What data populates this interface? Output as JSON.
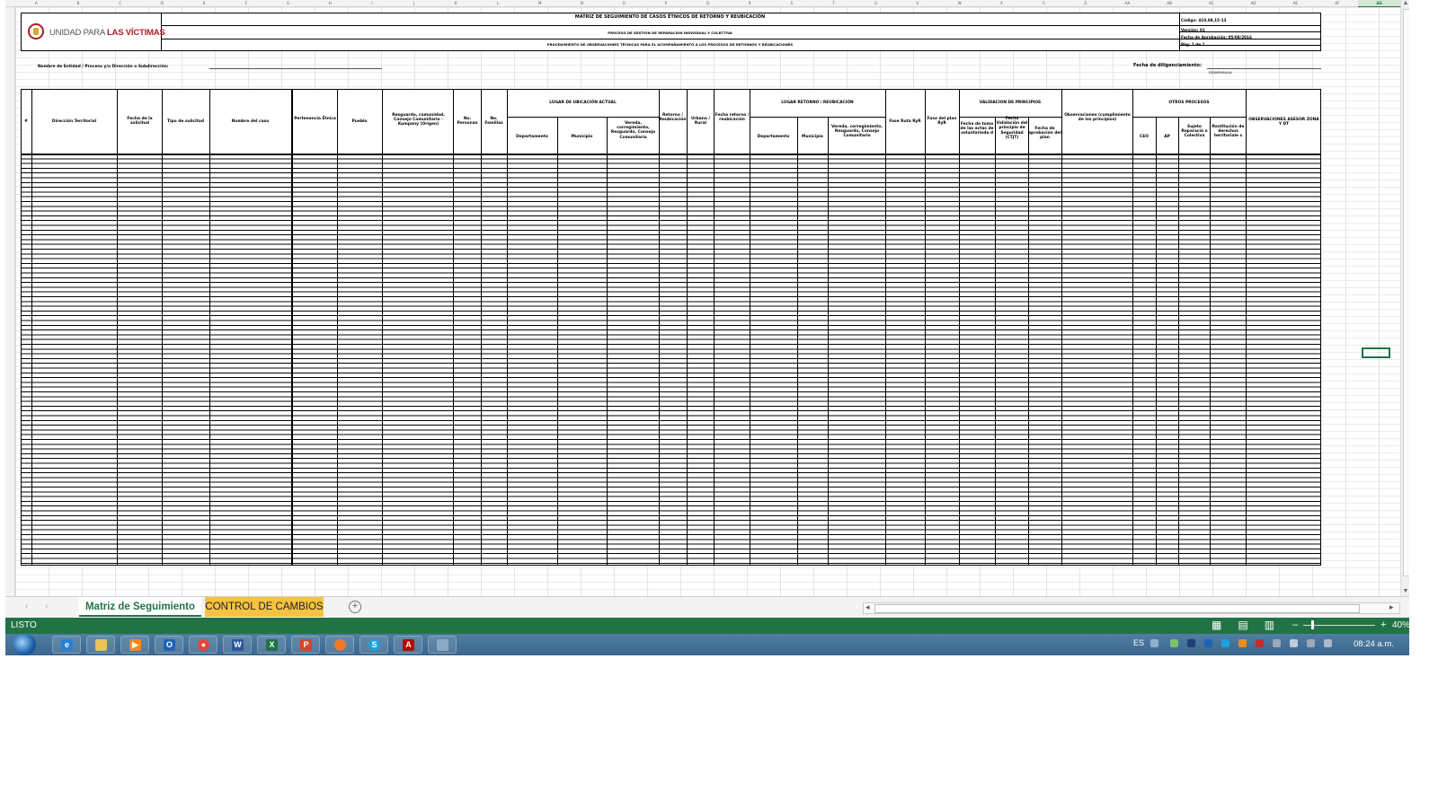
{
  "excel": {
    "columns": [
      "A",
      "B",
      "C",
      "D",
      "E",
      "F",
      "G",
      "H",
      "I",
      "J",
      "K",
      "L",
      "M",
      "N",
      "O",
      "P",
      "Q",
      "R",
      "S",
      "T",
      "U",
      "V",
      "W",
      "X",
      "Y",
      "Z",
      "AA",
      "AB",
      "AC",
      "AD",
      "AE",
      "AF",
      "AG"
    ],
    "selected_column": "AG",
    "header": {
      "title": "MATRIZ DE SEGUIMIENTO DE CASOS ÉTNICOS DE RETORNO Y REUBICACIÓN",
      "process": "PROCESO DE GESTIÓN DE REPARACIÓN INDIVIDUAL Y COLECTIVA",
      "procedure": "PROCEDIMIENTO DE OBSERVACIONES TÉCNICAS PARA EL ACOMPAÑAMIENTO A LOS PROCESOS DE RETORNOS Y REUBICACIONES",
      "code": "Código: 410,08,15-13",
      "version": "Versión: 01",
      "approval_date": "Fecha de Aprobación: 05/08/2016",
      "page": "Pág: 1 de 1"
    },
    "logo": {
      "text_main": "UNIDAD PARA ",
      "text_bold": "LAS VÍCTIMAS"
    },
    "entity_label": "Nombre de Entidad / Proceso y/o Dirección o Subdirección:",
    "date_label": "Fecha de diligenciamiento:",
    "date_format": "DD/MM/AAAA",
    "table": {
      "col_num": "#",
      "direccion": "Dirección Territorial",
      "fecha_solicitud": "Fecha de la solicitud",
      "tipo_solicitud": "Tipo de solicitud",
      "nombre_caso": "Nombre del caso",
      "pertenencia": "Pertenencia Étnica",
      "pueblo": "Pueblo",
      "resguardo": "Resguardo, comunidad, Consejo Comunitario - Kumpany (Origen)",
      "no_personas": "No. Personas",
      "no_familias": "No. Familias",
      "lugar_actual": "LUGAR DE UBICACIÓN ACTUAL",
      "departamento": "Departamento",
      "municipio": "Municipio",
      "vereda": "Vereda, corregimiento, Resguardo, Consejo Comunitario",
      "retorno_reubicacion": "Retorno / Reubicación",
      "urbano_rural": "Urbano / Rural",
      "fecha_retorno": "Fecha retorno / reubicación",
      "lugar_retorno": "LUGAR RETORNO / REUBICACIÓN",
      "fase_ruta": "Fase Ruta RyR",
      "fase_plan": "Fase del plan RyR",
      "validacion": "VALIDACION DE PRINCIPIOS",
      "fecha_toma": "Fecha de toma de las actas de voluntarieda d",
      "fecha_validacion": "Fecha Validación del principio de Seguridad (CTJT)",
      "fecha_aprobacion": "Fecha de aprobación del plan",
      "observaciones": "Observaciones (cumplimiento de los principios)",
      "otros": "OTROS PROCESOS",
      "ceo": "CEO",
      "ap": "AP",
      "sujeto": "Sujeto Reparació n Colectiva",
      "restitucion": "Restitución de derechos territoriale s",
      "obs_asesor": "OBSERVACIONES ASESOR ZONA Y DT"
    }
  },
  "tabs": [
    {
      "label": "Matriz de Seguimiento"
    },
    {
      "label": "CONTROL DE CAMBIOS"
    }
  ],
  "status": {
    "ready": "LISTO",
    "zoom": "40%"
  },
  "taskbar": {
    "lang": "ES",
    "time": "08:24 a.m."
  }
}
